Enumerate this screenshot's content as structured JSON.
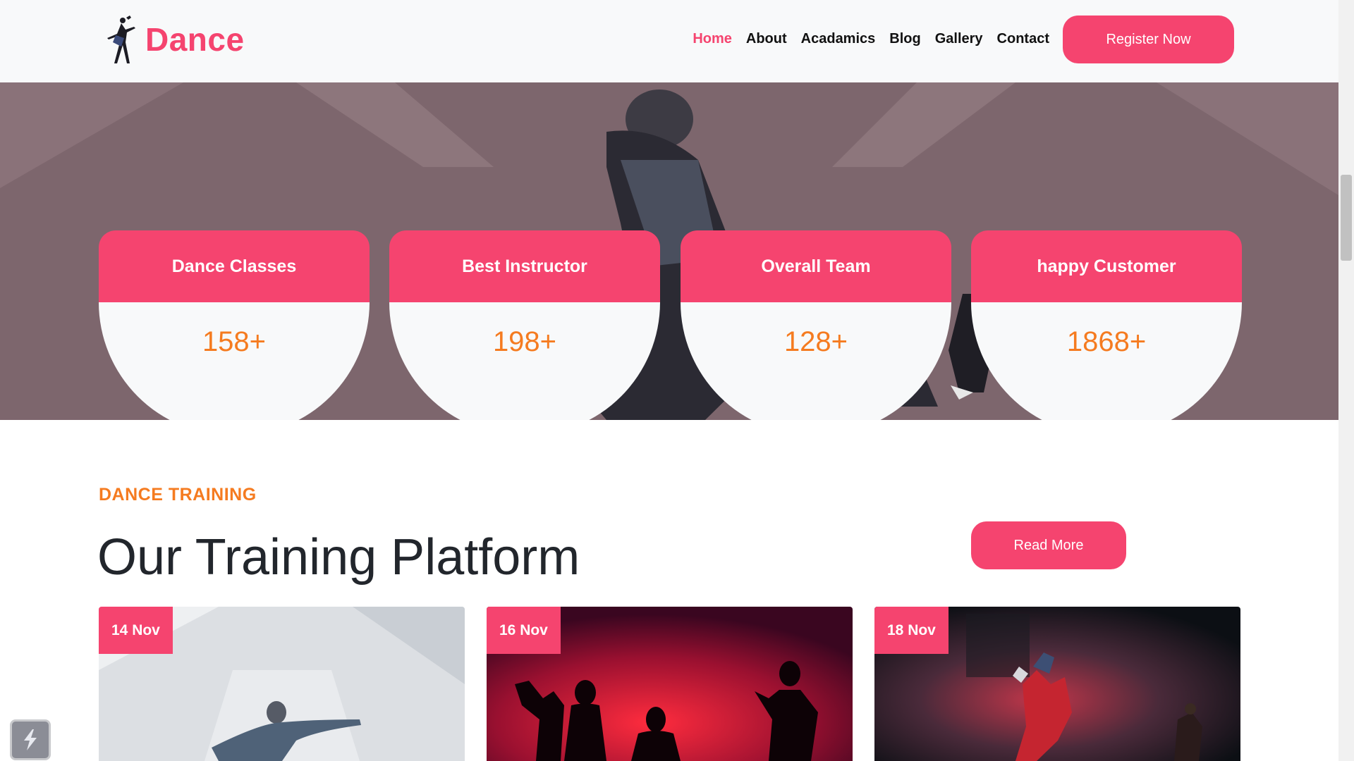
{
  "brand": {
    "name": "Dance",
    "accent": "#f5446f",
    "orange": "#f57b20"
  },
  "nav": {
    "items": [
      "Home",
      "About",
      "Acadamics",
      "Blog",
      "Gallery",
      "Contact"
    ],
    "active": "Home",
    "register_label": "Register Now"
  },
  "stats": [
    {
      "label": "Dance Classes",
      "value": "158+"
    },
    {
      "label": "Best Instructor",
      "value": "198+"
    },
    {
      "label": "Overall Team",
      "value": "128+"
    },
    {
      "label": "happy Customer",
      "value": "1868+"
    }
  ],
  "training": {
    "eyebrow": "DANCE TRAINING",
    "title": "Our Training Platform",
    "read_more_label": "Read More",
    "cards": [
      {
        "date": "14 Nov"
      },
      {
        "date": "16 Nov"
      },
      {
        "date": "18 Nov"
      }
    ]
  },
  "icons": {
    "logo": "dancing-couple-icon",
    "floating": "lightning-icon"
  }
}
